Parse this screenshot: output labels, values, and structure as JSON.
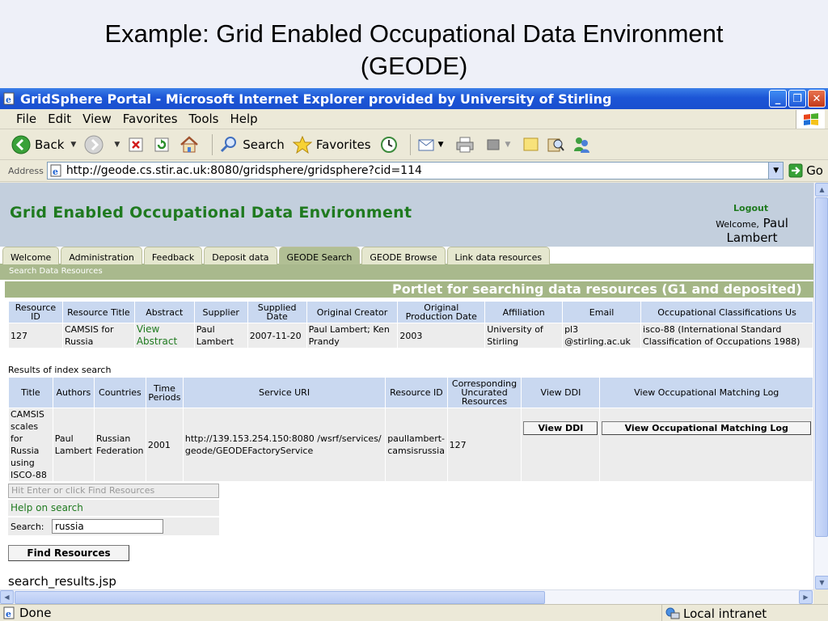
{
  "slide": {
    "title_line1": "Example: Grid Enabled Occupational Data Environment",
    "title_line2": "(GEODE)"
  },
  "window": {
    "title": "GridSphere Portal - Microsoft Internet Explorer provided by University of Stirling",
    "menu": [
      "File",
      "Edit",
      "View",
      "Favorites",
      "Tools",
      "Help"
    ],
    "toolbar": {
      "back": "Back",
      "search": "Search",
      "favorites": "Favorites"
    },
    "address_label": "Address",
    "url": "http://geode.cs.stir.ac.uk:8080/gridsphere/gridsphere?cid=114",
    "go": "Go"
  },
  "page": {
    "site_title": "Grid Enabled Occupational Data Environment",
    "logout": "Logout",
    "welcome_small": "Welcome,",
    "welcome_name_first": "Paul",
    "welcome_name_last": "Lambert",
    "tabs": [
      "Welcome",
      "Administration",
      "Feedback",
      "Deposit data",
      "GEODE Search",
      "GEODE Browse",
      "Link data resources"
    ],
    "active_tab": "GEODE Search",
    "subtab": "Search Data Resources",
    "portlet_title": "Portlet for searching data resources (G1 and deposited)",
    "resource_table": {
      "headers": [
        "Resource ID",
        "Resource Title",
        "Abstract",
        "Supplier",
        "Supplied Date",
        "Original Creator",
        "Original Production Date",
        "Affiliation",
        "Email",
        "Occupational Classifications Us"
      ],
      "row": [
        "127",
        "CAMSIS for Russia",
        "View Abstract",
        "Paul Lambert",
        "2007-11-20",
        "Paul Lambert; Ken Prandy",
        "2003",
        "University of Stirling",
        "pl3 @stirling.ac.uk",
        "isco-88 (International Standard Classification of Occupations 1988)"
      ]
    },
    "results_caption": "Results of index search",
    "results_table": {
      "headers": [
        "Title",
        "Authors",
        "Countries",
        "Time Periods",
        "Service URI",
        "Resource ID",
        "Corresponding Uncurated Resources",
        "View DDI",
        "View Occupational Matching Log"
      ],
      "row": [
        "CAMSIS scales for Russia using ISCO-88",
        "Paul Lambert",
        "Russian Federation",
        "2001",
        "http://139.153.254.150:8080 /wsrf/services/geode/GEODEFactoryService",
        "paullambert-camsisrussia",
        "127"
      ],
      "view_ddi_button": "View DDI",
      "view_log_button": "View Occupational Matching Log"
    },
    "hint_placeholder": "Hit Enter or click Find Resources",
    "help_link": "Help on search",
    "search_label": "Search:",
    "search_value": "russia",
    "find_button": "Find Resources",
    "jsp_name": "search_results.jsp"
  },
  "status": {
    "text": "Done",
    "zone": "Local intranet"
  }
}
